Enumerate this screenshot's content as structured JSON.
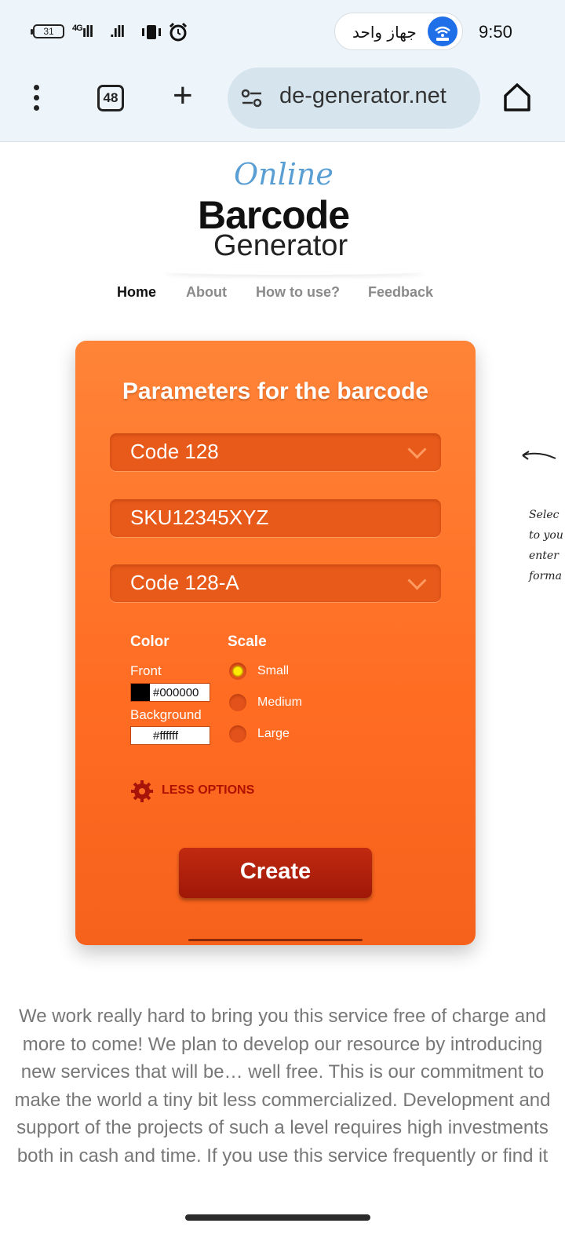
{
  "status_bar": {
    "battery": "31",
    "network": "4G",
    "wifi_name": "جهاز واحد",
    "time": "9:50"
  },
  "browser": {
    "tab_count": "48",
    "url": "de-generator.net"
  },
  "logo": {
    "line1": "Online",
    "line2": "Barcode",
    "line3": "Generator"
  },
  "nav": {
    "items": [
      {
        "label": "Home"
      },
      {
        "label": "About"
      },
      {
        "label": "How to use?"
      },
      {
        "label": "Feedback"
      }
    ]
  },
  "form": {
    "title": "Parameters for the barcode",
    "barcode_type": "Code 128",
    "data_value": "SKU12345XYZ",
    "subtype": "Code 128-A",
    "color_heading": "Color",
    "front_label": "Front",
    "front_value": "#000000",
    "background_label": "Background",
    "background_value": "#ffffff",
    "scale_heading": "Scale",
    "scale_options": [
      {
        "label": "Small",
        "selected": true
      },
      {
        "label": "Medium",
        "selected": false
      },
      {
        "label": "Large",
        "selected": false
      }
    ],
    "less_options": "LESS OPTIONS",
    "create_label": "Create",
    "accent": "#ff6c22",
    "button_color": "#b01f0a"
  },
  "side_note": {
    "lines": [
      "Selec",
      "to you",
      "enter",
      "forma"
    ]
  },
  "body_text": "We work really hard to bring you this service free of charge and more to come! We plan to develop our resource by introducing new services that will be… well free. This is our commitment to make the world a tiny bit less commercialized. Development and support of the projects of such a level requires high investments both in cash and time. If you use this service frequently or find it"
}
